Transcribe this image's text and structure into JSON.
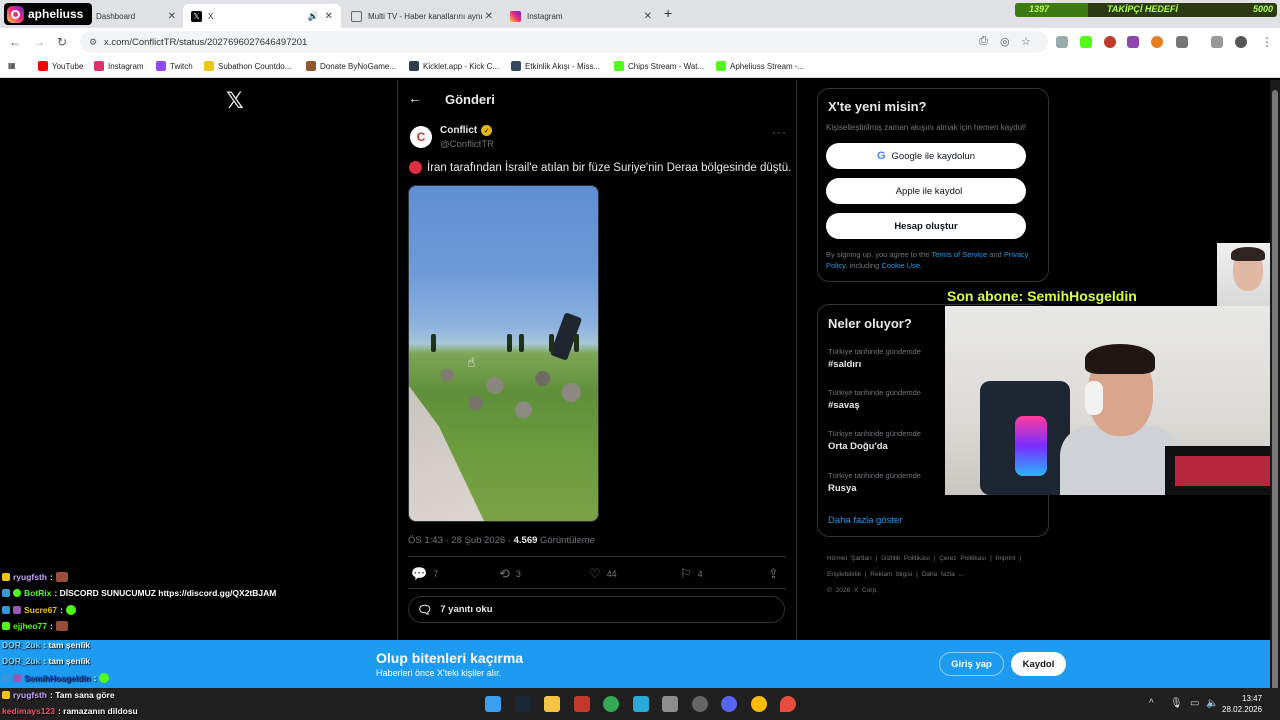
{
  "streamer": {
    "name": "apheliuss"
  },
  "follow_goal": {
    "current": "1397",
    "label": "TAKİPÇİ HEDEFİ",
    "target": "5000",
    "fraction": 0.28
  },
  "tabs": [
    {
      "label": "Dashboard",
      "favicon_color": "#53fc18"
    },
    {
      "label": "X",
      "favicon_color": "#000000"
    },
    {
      "label": "Multi TV - Haber kanallarını aynı",
      "favicon_color": "#666666"
    },
    {
      "label": "Instagram",
      "favicon_color": "#e1306c"
    }
  ],
  "address": {
    "url": "x.com/ConflictTR/status/2027696027646497201"
  },
  "bookmarks": [
    {
      "label": "YouTube",
      "color": "#ff0000"
    },
    {
      "label": "Instagram",
      "color": "#e1306c"
    },
    {
      "label": "Twitch",
      "color": "#9146ff"
    },
    {
      "label": "Subathon Countdo...",
      "color": "#f1c40f"
    },
    {
      "label": "Donate ByNoGame...",
      "color": "#8e5a2b"
    },
    {
      "label": "Kicklet.app - Kick C...",
      "color": "#2c3e50"
    },
    {
      "label": "Etkinlik Akışı - Miss...",
      "color": "#34495e"
    },
    {
      "label": "Chips Stream - Wat...",
      "color": "#53fc18"
    },
    {
      "label": "Apheliuss Stream -...",
      "color": "#53fc18"
    }
  ],
  "page": {
    "title": "Gönderi"
  },
  "tweet": {
    "author": "Conflict",
    "handle": "@ConflictTR",
    "text": "İran tarafından İsrail'e atılan bir füze Suriye'nin Deraa bölgesinde düştü.",
    "time": "ÖS 1:43 · 28 Şub 2026 · ",
    "views": "4.569",
    "views_label": " Görüntüleme",
    "replies": "7",
    "reposts": "3",
    "likes": "44",
    "bookmarks": "4",
    "read_replies": "7 yanıtı oku"
  },
  "signup": {
    "title": "X'te yeni misin?",
    "desc": "Kişiselleştirilmiş zaman akışını almak için hemen kaydol!",
    "google": "Google ile kaydolun",
    "apple": "Apple ile kaydol",
    "create": "Hesap oluştur",
    "terms_pre": "By signing up, you agree to the ",
    "terms_tos": "Terms of Service",
    "terms_and": " and ",
    "terms_privacy": "Privacy Policy",
    "terms_incl": ", including ",
    "terms_cookie": "Cookie Use."
  },
  "trends": {
    "title": "Neler oluyor?",
    "items": [
      {
        "category": "Türkiye tarihinde gündemde",
        "tag": "#saldırı"
      },
      {
        "category": "Türkiye tarihinde gündemde",
        "tag": "#savaş"
      },
      {
        "category": "Türkiye tarihinde gündemde",
        "tag": "Orta Doğu'da"
      },
      {
        "category": "Türkiye tarihinde gündemde",
        "tag": "Rusya"
      }
    ],
    "show_more": "Daha fazla göster"
  },
  "footer": {
    "links": [
      "Hizmet Şartları",
      "Gizlilik Politikası",
      "Çerez Politikası",
      "Imprint",
      "Erişilebilirlik",
      "Reklam bilgisi",
      "Daha fazla ...",
      "© 2026 X Corp."
    ]
  },
  "overlay": {
    "son_abone": "Son abone: SemihHosgeldin"
  },
  "chat": [
    {
      "user": "ryugfsth",
      "msg": ":",
      "color": "#c9a3ff"
    },
    {
      "user": "BotRix",
      "msg": ": DİSCORD SUNUCUMUZ https://discord.gg/QX2tBJAM",
      "color": "#53fc18"
    },
    {
      "user": "Sucre67",
      "msg": ":",
      "color": "#f1c40f"
    },
    {
      "user": "ejjheo77",
      "msg": ":",
      "color": "#53fc18"
    },
    {
      "user": "DOR_2uk",
      "msg": ": tam şenlik",
      "color": "#7ad3ff"
    },
    {
      "user": "DOR_2uk",
      "msg": ": tam şenlik",
      "color": "#7ad3ff"
    },
    {
      "user": "SemihHosgeldin",
      "msg": ":",
      "color": "#1d4fbf"
    },
    {
      "user": "ryugfsth",
      "msg": ": Tam sana göre",
      "color": "#c9a3ff"
    },
    {
      "user": "kedimays123",
      "msg": ": ramazanın dildosu",
      "color": "#ff4d6d"
    }
  ],
  "banner": {
    "title": "Olup bitenleri kaçırma",
    "subtitle": "Haberleri önce X'teki kişiler alır.",
    "login": "Giriş yap",
    "register": "Kaydol"
  },
  "clock": {
    "time": "13:47",
    "date": "28.02.2026"
  }
}
